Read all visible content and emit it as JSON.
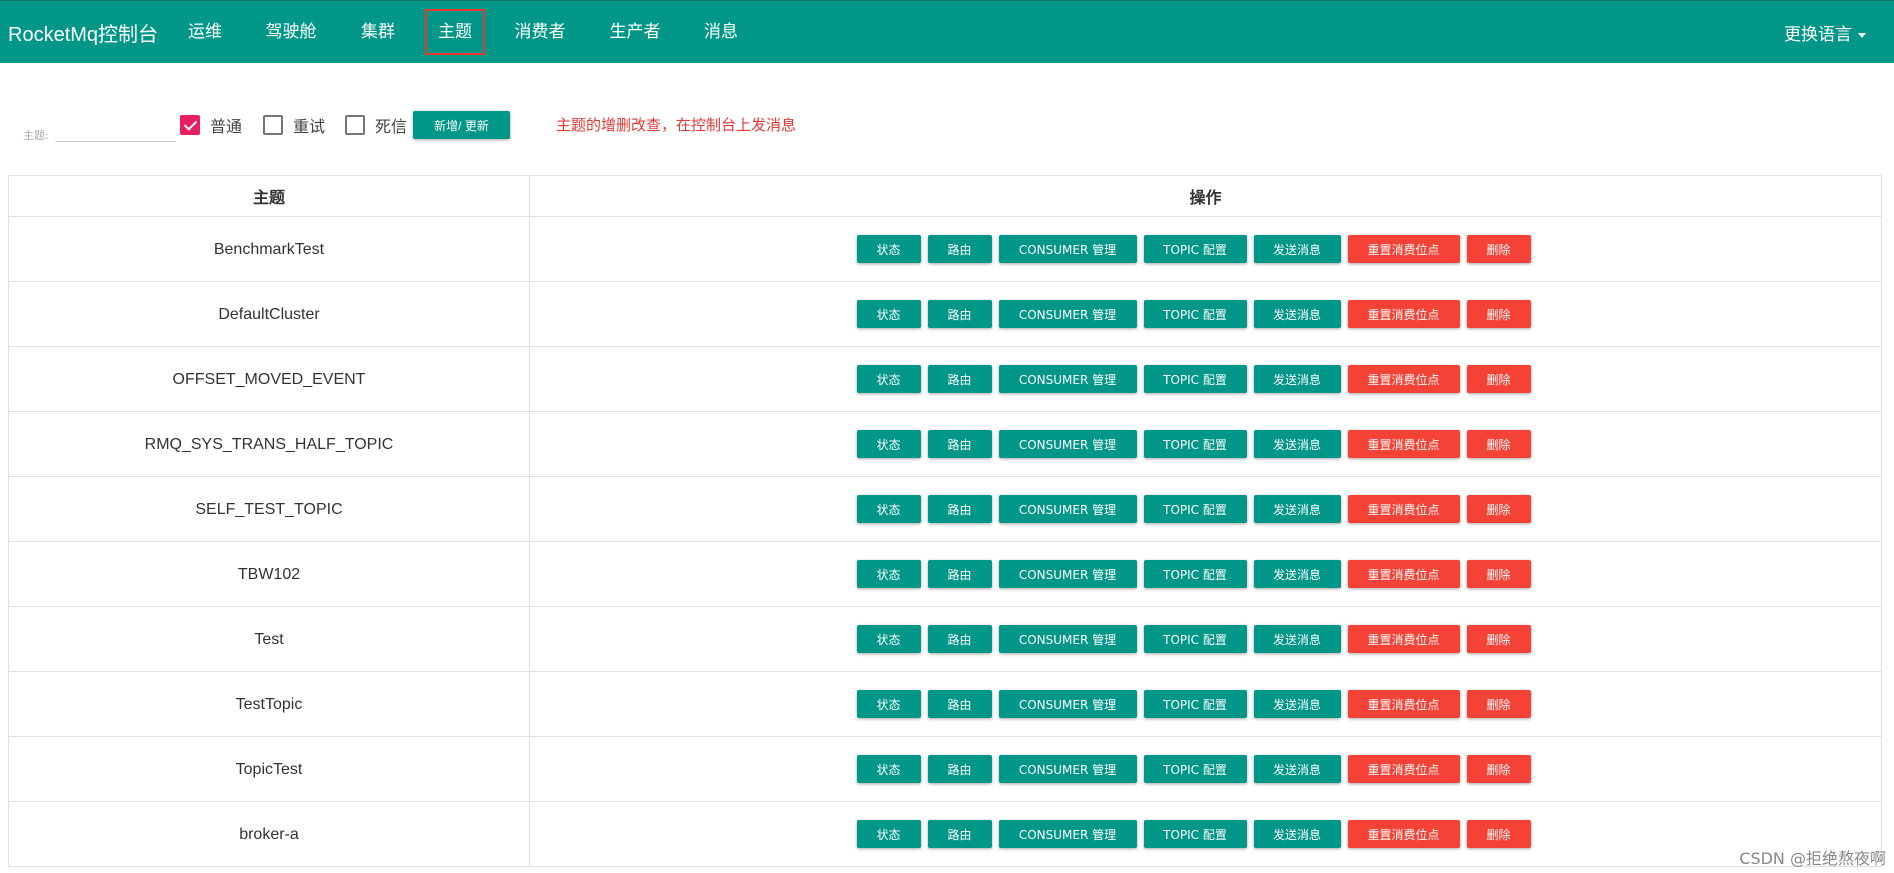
{
  "app": {
    "brand": "RocketMq控制台",
    "nav": [
      "运维",
      "驾驶舱",
      "集群",
      "主题",
      "消费者",
      "生产者",
      "消息"
    ],
    "active_nav": "主题",
    "language_label": "更换语言",
    "colors": {
      "primary": "#009688",
      "danger": "#f44336",
      "checked": "#e91e63",
      "highlight": "#e53935"
    }
  },
  "filter": {
    "topic_label": "主题:",
    "topic_value": "",
    "checkboxes": [
      {
        "label": "普通",
        "checked": true
      },
      {
        "label": "重试",
        "checked": false
      },
      {
        "label": "死信",
        "checked": false
      }
    ],
    "add_button": "新增/ 更新",
    "note": "主题的增删改查，在控制台上发消息"
  },
  "table": {
    "headers": {
      "topic": "主题",
      "operation": "操作"
    },
    "actions": {
      "status": "状态",
      "route": "路由",
      "consumer": "CONSUMER 管理",
      "config": "TOPIC 配置",
      "send": "发送消息",
      "reset": "重置消费位点",
      "delete": "删除"
    },
    "rows": [
      "BenchmarkTest",
      "DefaultCluster",
      "OFFSET_MOVED_EVENT",
      "RMQ_SYS_TRANS_HALF_TOPIC",
      "SELF_TEST_TOPIC",
      "TBW102",
      "Test",
      "TestTopic",
      "TopicTest",
      "broker-a"
    ]
  },
  "watermark": "CSDN @拒绝熬夜啊"
}
